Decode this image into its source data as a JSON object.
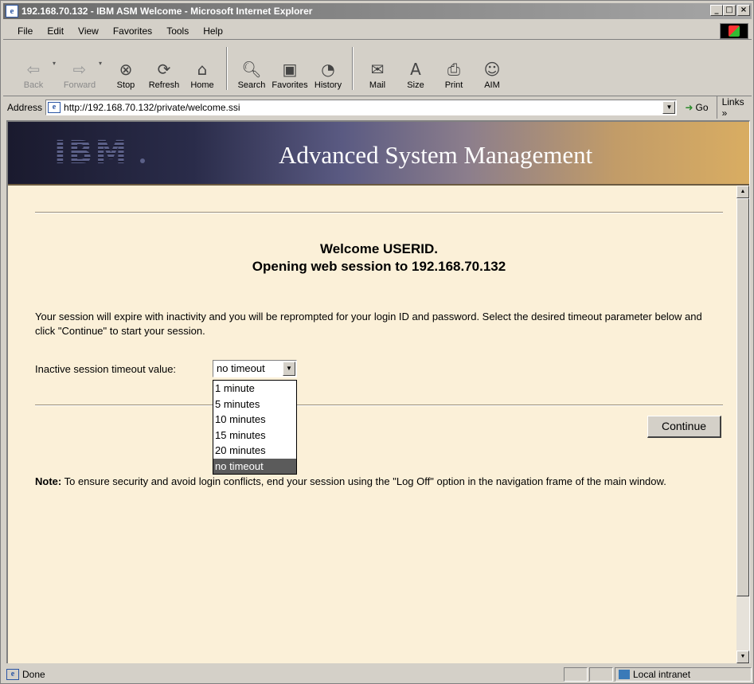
{
  "window": {
    "title": "192.168.70.132 - IBM ASM Welcome - Microsoft Internet Explorer",
    "controls": [
      "_",
      "□",
      "×"
    ]
  },
  "menu": {
    "items": [
      {
        "label": "File"
      },
      {
        "label": "Edit"
      },
      {
        "label": "View"
      },
      {
        "label": "Favorites"
      },
      {
        "label": "Tools"
      },
      {
        "label": "Help"
      }
    ]
  },
  "toolbar": {
    "back": "Back",
    "forward": "Forward",
    "stop": "Stop",
    "refresh": "Refresh",
    "home": "Home",
    "search": "Search",
    "favorites": "Favorites",
    "history": "History",
    "mail": "Mail",
    "size": "Size",
    "print": "Print",
    "aim": "AIM"
  },
  "address": {
    "label": "Address",
    "url": "http://192.168.70.132/private/welcome.ssi",
    "go": "Go",
    "links": "Links »"
  },
  "banner": {
    "logo": "IBM",
    "title": "Advanced System Management"
  },
  "page": {
    "welcome_line1": "Welcome USERID.",
    "welcome_line2": "Opening web session to 192.168.70.132",
    "session_text": "Your session will expire with inactivity and you will be reprompted for your login ID and password. Select the desired timeout parameter below and click \"Continue\" to start your session.",
    "timeout_label": "Inactive session timeout value:",
    "timeout_selected": "no timeout",
    "timeout_options": [
      "1 minute",
      "5 minutes",
      "10 minutes",
      "15 minutes",
      "20 minutes",
      "no timeout"
    ],
    "continue_button": "Continue",
    "note_label": "Note:",
    "note_text": " To ensure security and avoid login conflicts, end your session using the \"Log Off\" option in the navigation frame of the main window."
  },
  "status": {
    "text": "Done",
    "zone": "Local intranet"
  }
}
